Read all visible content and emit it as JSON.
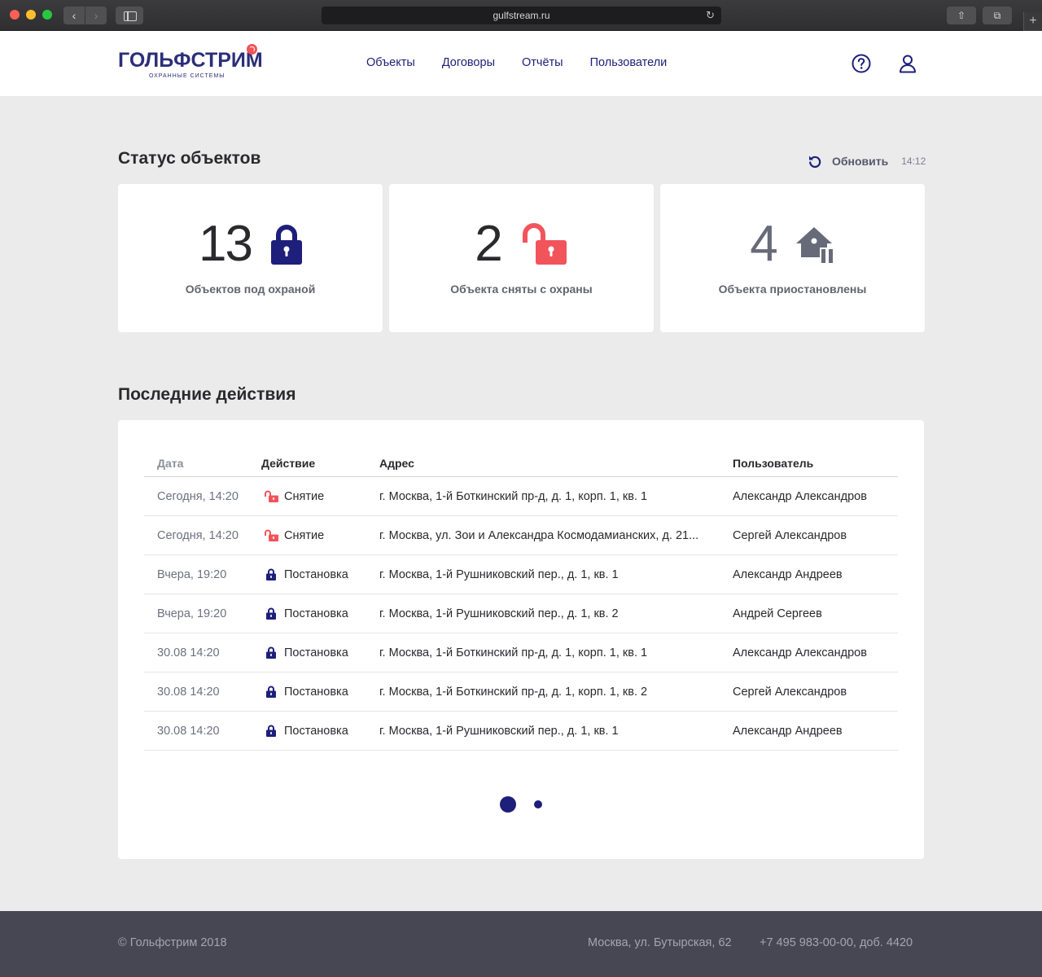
{
  "browser": {
    "url": "gulfstream.ru"
  },
  "header": {
    "logo_name": "ГОЛЬФСТРИМ",
    "logo_tagline": "ОХРАННЫЕ СИСТЕМЫ",
    "nav": [
      "Объекты",
      "Договоры",
      "Отчёты",
      "Пользователи"
    ]
  },
  "status": {
    "title": "Статус объектов",
    "refresh_label": "Обновить",
    "refresh_time": "14:12",
    "cards": [
      {
        "count": "13",
        "caption": "Объектов под охраной",
        "icon": "lock-closed-icon",
        "color": "#1d1f7a"
      },
      {
        "count": "2",
        "caption": "Объекта сняты с охраны",
        "icon": "lock-open-icon",
        "color": "#f2545b"
      },
      {
        "count": "4",
        "caption": "Объекта приостановлены",
        "icon": "house-pause-icon",
        "color": "#676a78"
      }
    ]
  },
  "actions": {
    "title": "Последние действия",
    "columns": [
      "Дата",
      "Действие",
      "Адрес",
      "Пользователь"
    ],
    "rows": [
      {
        "date": "Сегодня, 14:20",
        "action": "Снятие",
        "type": "disarm",
        "address": "г. Москва, 1-й Боткинский пр-д, д. 1, корп. 1, кв. 1",
        "user": "Александр Александров"
      },
      {
        "date": "Сегодня, 14:20",
        "action": "Снятие",
        "type": "disarm",
        "address": "г. Москва, ул. Зои и Александра Космодамианских, д. 21...",
        "user": "Сергей Александров"
      },
      {
        "date": "Вчера, 19:20",
        "action": "Постановка",
        "type": "arm",
        "address": "г. Москва, 1-й Рушниковский пер., д. 1, кв. 1",
        "user": "Александр Андреев"
      },
      {
        "date": "Вчера, 19:20",
        "action": "Постановка",
        "type": "arm",
        "address": "г. Москва, 1-й Рушниковский пер., д. 1, кв. 2",
        "user": "Андрей Сергеев"
      },
      {
        "date": "30.08  14:20",
        "action": "Постановка",
        "type": "arm",
        "address": "г. Москва, 1-й Боткинский пр-д, д. 1, корп. 1, кв. 1",
        "user": "Александр Александров"
      },
      {
        "date": "30.08  14:20",
        "action": "Постановка",
        "type": "arm",
        "address": "г. Москва, 1-й Боткинский пр-д, д. 1, корп. 1, кв. 2",
        "user": "Сергей Александров"
      },
      {
        "date": "30.08  14:20",
        "action": "Постановка",
        "type": "arm",
        "address": "г. Москва, 1-й Рушниковский пер., д. 1, кв. 1",
        "user": "Александр Андреев"
      }
    ],
    "pages": 2,
    "current_page": 1
  },
  "footer": {
    "copyright": "© Гольфстрим 2018",
    "address": "Москва, ул. Бутырская, 62",
    "phone": "+7 495 983-00-00, доб. 4420"
  },
  "colors": {
    "brand": "#1d1f7a",
    "alert": "#f2545b",
    "footer_bg": "#464752"
  }
}
